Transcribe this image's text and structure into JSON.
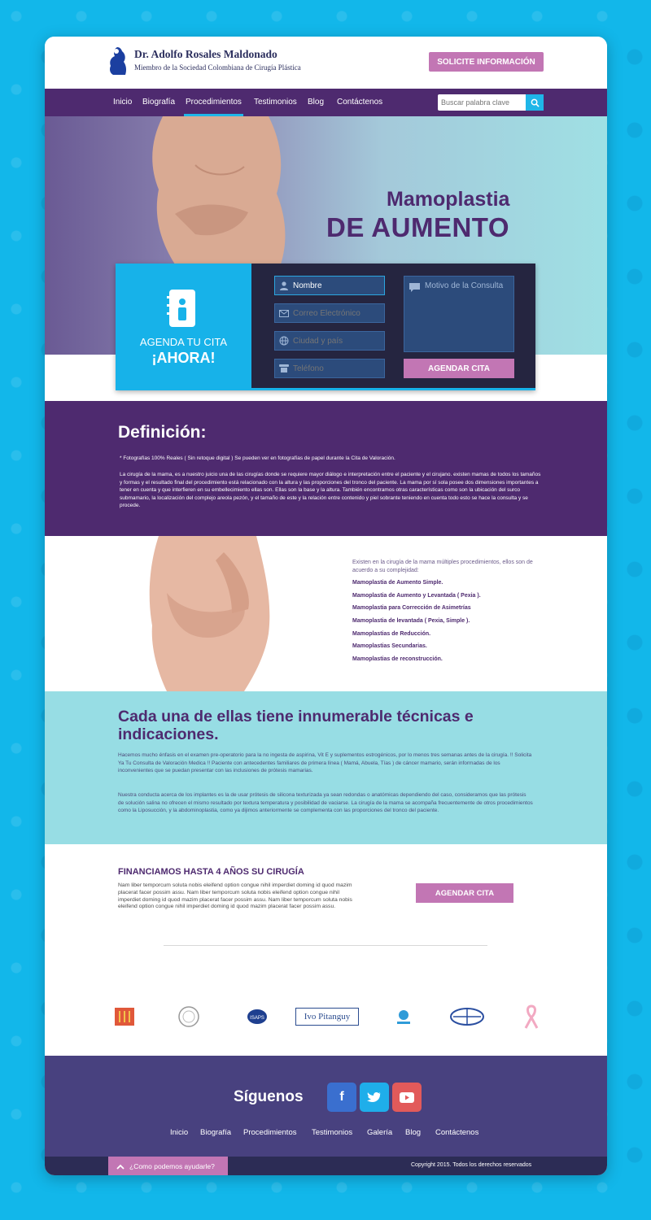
{
  "header": {
    "doctor_name": "Dr. Adolfo Rosales Maldonado",
    "doctor_subtitle": "Miembro de la Sociedad Colombiana de Cirugía Plástica",
    "cta_label": "SOLICITE INFORMACIÓN"
  },
  "nav": {
    "items": [
      {
        "label": "Inicio"
      },
      {
        "label": "Biografía"
      },
      {
        "label": "Procedimientos",
        "active": true
      },
      {
        "label": "Testimonios"
      },
      {
        "label": "Blog"
      },
      {
        "label": "Contáctenos"
      }
    ],
    "search_placeholder": "Buscar palabra clave"
  },
  "hero": {
    "title_line1": "Mamoplastia",
    "title_line2": "DE AUMENTO"
  },
  "appointment": {
    "heading_line1": "AGENDA TU CITA",
    "heading_line2": "¡AHORA!",
    "fields": {
      "name_value": "Nombre",
      "email_placeholder": "Correo Electrónico",
      "city_placeholder": "Ciudad y país",
      "phone_placeholder": "Teléfono",
      "reason_placeholder": "Motivo de la Consulta"
    },
    "submit_label": "AGENDAR CITA"
  },
  "definition": {
    "title": "Definición:",
    "note": "* Fotografías 100% Reales ( Sin retoque digital ) Se pueden ver en fotografías de papel durante la Cita de Valoración.",
    "body": "La cirugía de la mama, es a nuestro juicio una de las cirugías donde se requiere mayor diálogo e interpretación entre el paciente y el cirujano. existen mamas de todos los tamaños y formas y el resultado final del procedimiento está relacionado con la altura y las proporciones del tronco del paciente. La mama por sí sola posee dos dimensiones importantes a tener en cuenta y que interfieren en su embellecimiento ellas son. Ellas son la base y la altura. También encontramos otras características como son la ubicación del surco submamario, la localización del complejo areola pezón, y el tamaño de este y la relación entre contenido y piel sobrante teniendo en cuenta todo esto se hace la consulta y se procede."
  },
  "procedures": {
    "intro": "Existen en la cirugía de la mama múltiples procedimientos, ellos son de acuerdo a su complejidad:",
    "items": [
      "Mamoplastia de Aumento Simple.",
      "Mamoplastia de Aumento y Levantada ( Pexia ).",
      "Mamoplastia para Corrección de Asimetrías",
      "Mamoplastia de levantada ( Pexia, Simple ).",
      "Mamoplastias de Reducción.",
      "Mamoplastias Secundarias.",
      "Mamoplastias de reconstrucción."
    ]
  },
  "techniques": {
    "title": "Cada una de ellas tiene innumerable técnicas e indicaciones.",
    "p1": "Hacemos mucho énfasis en el examen pre-operatorio para la no ingesta de aspirina, Vit E y suplementos estrogénicos, por lo menos tres semanas antes de la cirugía. !! Solicita Ya Tu Consulta de Valoración Medica !! Paciente con antecedentes familiares de primera línea ( Mamá, Abuela, Tías ) de cáncer mamario, serán informadas de los inconvenientes que se puedan presentar con las inclusiones de prótesis mamarias.",
    "p2": "Nuestra conducta acerca de los implantes es la de usar prótesis de silicona texturizada ya sean redondas o anatómicas dependiendo del caso, consideramos que las prótesis de solución salina no ofrecen el mismo resultado por textura temperatura y posibilidad de vaciarse. La cirugía de la mama se acompaña frecuentemente de otros procedimientos como la Liposucción, y la abdominoplastia, como ya dijimos anteriormente se complementa con las proporciones del tronco del paciente."
  },
  "finance": {
    "title": "FINANCIAMOS HASTA 4 AÑOS SU CIRUGÍA",
    "text": "Nam liber temporcum soluta nobis eleifend option congue nihil imperdiet doming id quod mazim placerat facer possim assu. Nam liber temporcum soluta nobis eleifend option congue nihil imperdiet doming id quod mazim placerat facer possim assu.  Nam liber temporcum soluta nobis eleifend option congue nihil imperdiet doming id quod mazim placerat facer possim assu.",
    "button_label": "AGENDAR CITA",
    "partner_logo_text": "Ivo Pitanguy",
    "partner_isaps_text": "ISAPS"
  },
  "footer": {
    "follow_label": "Síguenos",
    "social": [
      {
        "icon": "facebook-icon",
        "glyph": "f",
        "color": "#3a6fcf"
      },
      {
        "icon": "twitter-icon",
        "glyph": "t",
        "color": "#1faeea"
      },
      {
        "icon": "youtube-icon",
        "glyph": "▶",
        "color": "#e25a5a"
      }
    ],
    "nav": [
      "Inicio",
      "Biografía",
      "Procedimientos",
      "Testimonios",
      "Galería",
      "Blog",
      "Contáctenos"
    ],
    "help_label": "¿Como podemos ayudarle?",
    "copyright": "Copyright 2015. Todos los derechos reservados"
  },
  "colors": {
    "primary_purple": "#4e2a6f",
    "accent_blue": "#17b2e9",
    "button_pink": "#c276b4",
    "teal_band": "#97dde4"
  }
}
